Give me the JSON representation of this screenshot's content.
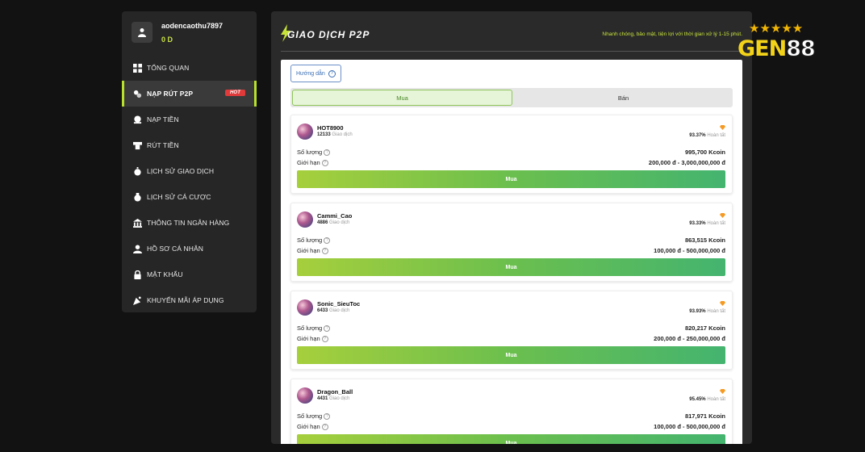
{
  "user": {
    "name": "aodencaothu7897",
    "balance": "0 D"
  },
  "menu": [
    {
      "label": "TỔNG QUAN",
      "icon": "grid-icon",
      "active": false
    },
    {
      "label": "NẠP RÚT P2P",
      "icon": "exchange-icon",
      "active": true,
      "badge": "HOT"
    },
    {
      "label": "NẠP TIỀN",
      "icon": "deposit-icon",
      "active": false
    },
    {
      "label": "RÚT TIỀN",
      "icon": "withdraw-icon",
      "active": false
    },
    {
      "label": "LỊCH SỬ GIAO DỊCH",
      "icon": "history-icon",
      "active": false
    },
    {
      "label": "LỊCH SỬ CÁ CƯỢC",
      "icon": "bet-history-icon",
      "active": false
    },
    {
      "label": "THÔNG TIN NGÂN HÀNG",
      "icon": "bank-icon",
      "active": false
    },
    {
      "label": "HỒ SƠ CÁ NHÂN",
      "icon": "profile-icon",
      "active": false
    },
    {
      "label": "MẬT KHẨU",
      "icon": "lock-icon",
      "active": false
    },
    {
      "label": "KHUYẾN MÃI ÁP DỤNG",
      "icon": "promo-icon",
      "active": false
    }
  ],
  "main": {
    "title": "GIAO DỊCH P2P",
    "subtitle": "Nhanh chóng, bảo mật, tiện lợi với thời gian xử lý 1-15 phút.",
    "guide_label": "Hướng dẫn",
    "tabs": [
      {
        "label": "Mua",
        "active": true
      },
      {
        "label": "Bán",
        "active": false
      }
    ],
    "qty_label": "Số lượng",
    "limit_label": "Giới hạn",
    "trades_label": "Giao dịch",
    "done_label": "Hoàn tất",
    "buy_label": "Mua",
    "offers": [
      {
        "name": "HOT8900",
        "trades": "12133",
        "pct": "93.37%",
        "qty": "995,700 Kcoin",
        "limit": "200,000 đ - 3,000,000,000 đ"
      },
      {
        "name": "Cammi_Cao",
        "trades": "4886",
        "pct": "93.33%",
        "qty": "863,515 Kcoin",
        "limit": "100,000 đ - 500,000,000 đ"
      },
      {
        "name": "Sonic_SieuToc",
        "trades": "6433",
        "pct": "93.93%",
        "qty": "820,217 Kcoin",
        "limit": "200,000 đ - 250,000,000 đ"
      },
      {
        "name": "Dragon_Ball",
        "trades": "4431",
        "pct": "95.45%",
        "qty": "817,971 Kcoin",
        "limit": "100,000 đ - 500,000,000 đ"
      }
    ]
  },
  "brand": {
    "name_a": "GEN",
    "name_b": "88",
    "stars": "★★★★★",
    "accent": "#b7e12b"
  }
}
